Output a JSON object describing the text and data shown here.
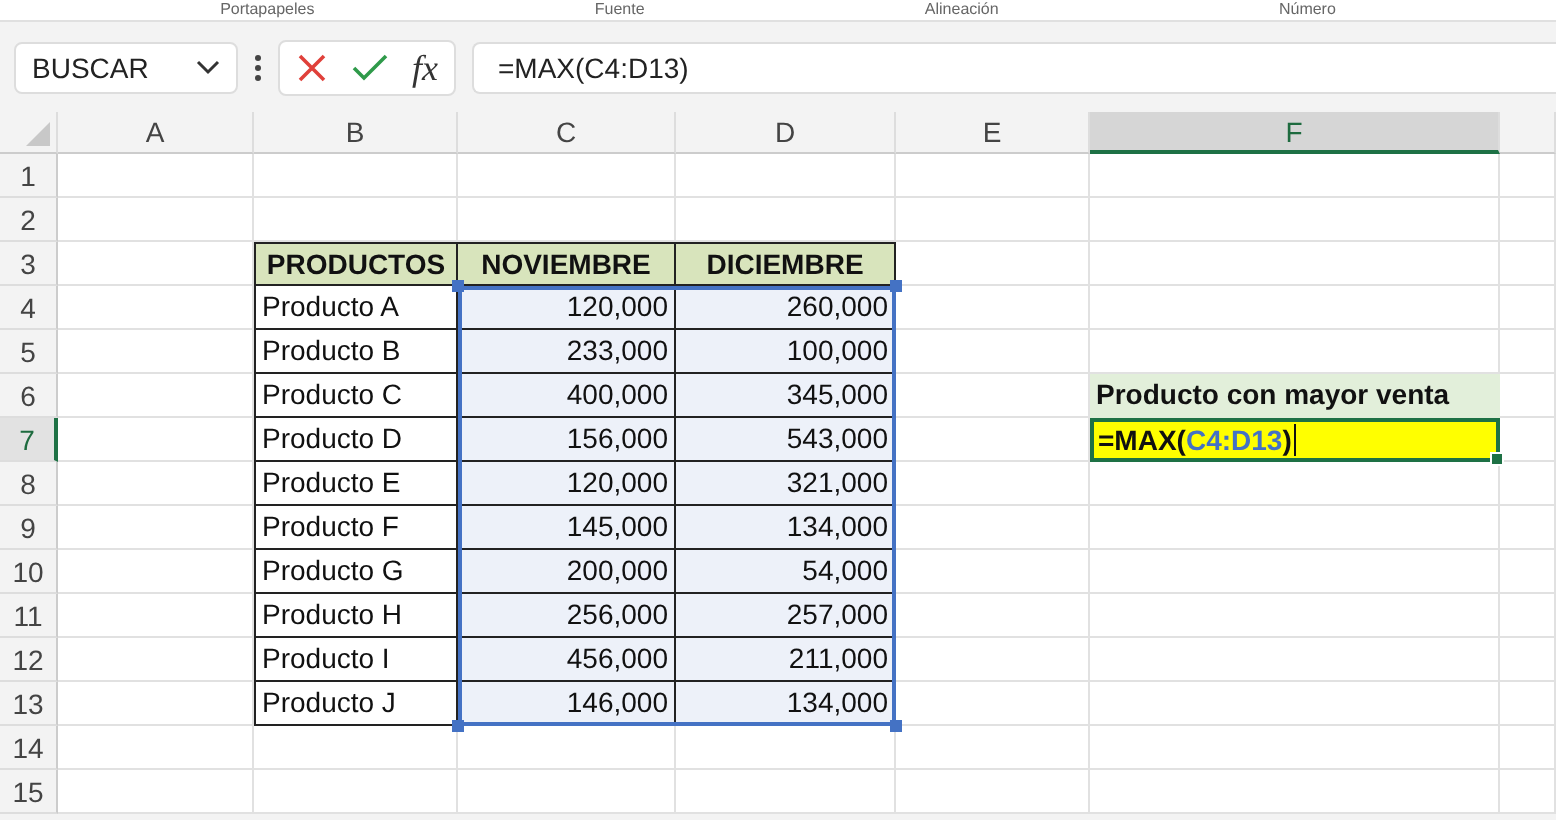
{
  "ribbon": {
    "groups": [
      "Portapapeles",
      "Fuente",
      "Alineación",
      "Número"
    ]
  },
  "name_box": {
    "value": "BUSCAR"
  },
  "formula_bar": {
    "fx_label": "fx",
    "value": "=MAX(C4:D13)"
  },
  "columns": [
    {
      "label": "A",
      "selected": false
    },
    {
      "label": "B",
      "selected": false
    },
    {
      "label": "C",
      "selected": false
    },
    {
      "label": "D",
      "selected": false
    },
    {
      "label": "E",
      "selected": false
    },
    {
      "label": "F",
      "selected": true
    }
  ],
  "rows": [
    {
      "label": "1",
      "selected": false
    },
    {
      "label": "2",
      "selected": false
    },
    {
      "label": "3",
      "selected": false
    },
    {
      "label": "4",
      "selected": false
    },
    {
      "label": "5",
      "selected": false
    },
    {
      "label": "6",
      "selected": false
    },
    {
      "label": "7",
      "selected": true
    },
    {
      "label": "8",
      "selected": false
    },
    {
      "label": "9",
      "selected": false
    },
    {
      "label": "10",
      "selected": false
    },
    {
      "label": "11",
      "selected": false
    },
    {
      "label": "12",
      "selected": false
    },
    {
      "label": "13",
      "selected": false
    },
    {
      "label": "14",
      "selected": false
    },
    {
      "label": "15",
      "selected": false
    }
  ],
  "table": {
    "columns": [
      {
        "label": "PRODUCTOS",
        "in_selection": false
      },
      {
        "label": "NOVIEMBRE",
        "in_selection": true
      },
      {
        "label": "DICIEMBRE",
        "in_selection": true
      }
    ],
    "rows": [
      [
        "Producto A",
        "120,000",
        "260,000"
      ],
      [
        "Producto B",
        "233,000",
        "100,000"
      ],
      [
        "Producto C",
        "400,000",
        "345,000"
      ],
      [
        "Producto D",
        "156,000",
        "543,000"
      ],
      [
        "Producto E",
        "120,000",
        "321,000"
      ],
      [
        "Producto F",
        "145,000",
        "134,000"
      ],
      [
        "Producto G",
        "200,000",
        "54,000"
      ],
      [
        "Producto H",
        "256,000",
        "257,000"
      ],
      [
        "Producto I",
        "456,000",
        "211,000"
      ],
      [
        "Producto J",
        "146,000",
        "134,000"
      ]
    ]
  },
  "label_cell": {
    "text": "Producto con mayor venta"
  },
  "active_cell": {
    "parts": [
      {
        "kind": "plain",
        "text": "=MAX("
      },
      {
        "kind": "ref",
        "text": "C4:D13"
      },
      {
        "kind": "plain",
        "text": ")"
      }
    ]
  }
}
